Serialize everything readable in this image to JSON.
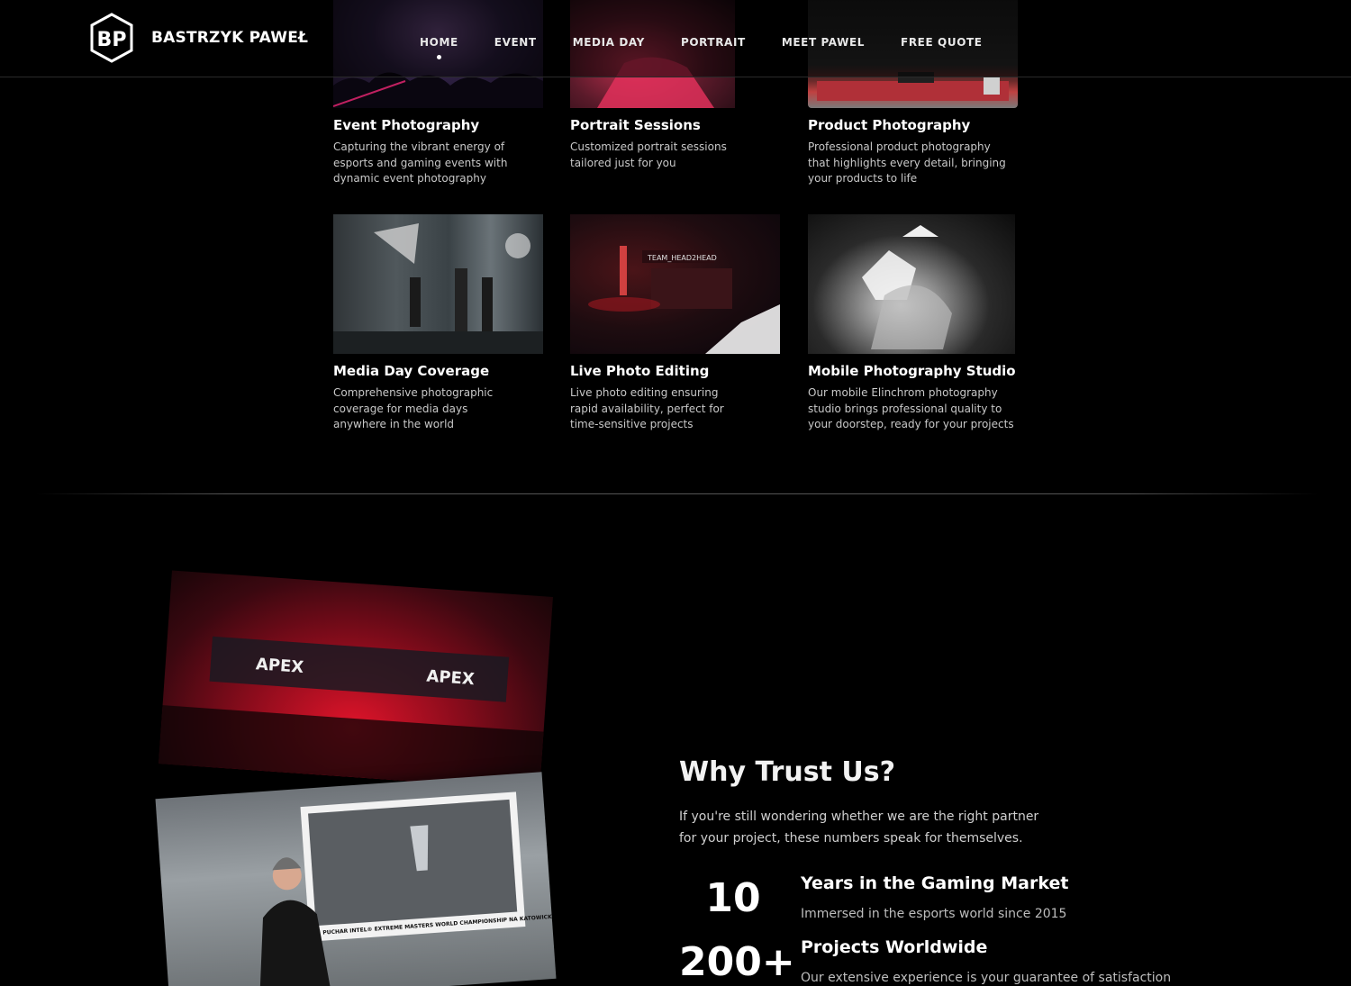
{
  "header": {
    "brand": "BASTRZYK PAWEŁ",
    "nav": [
      {
        "label": "HOME",
        "active": true
      },
      {
        "label": "EVENT"
      },
      {
        "label": "MEDIA DAY"
      },
      {
        "label": "PORTRAIT"
      },
      {
        "label": "MEET PAWEL"
      },
      {
        "label": "FREE QUOTE"
      }
    ]
  },
  "services": [
    {
      "title": "Event Photography",
      "description": "Capturing the vibrant energy of esports and gaming events with dynamic event photography"
    },
    {
      "title": "Portrait Sessions",
      "description": "Customized portrait sessions tailored just for you"
    },
    {
      "title": "Product Photography",
      "description": "Professional product photography that highlights every detail, bringing your products to life"
    },
    {
      "title": "Media Day Coverage",
      "description": "Comprehensive photographic coverage for media days anywhere in the world"
    },
    {
      "title": "Live Photo Editing",
      "description": "Live photo editing ensuring rapid availability, perfect for time-sensitive projects"
    },
    {
      "title": "Mobile Photography Studio",
      "description": "Our mobile Elinchrom photography studio brings professional quality to your doorstep, ready for your projects"
    }
  ],
  "trust": {
    "title": "Why Trust Us?",
    "intro": "If you're still wondering whether we are the right partner for your project, these numbers speak for themselves.",
    "stats": [
      {
        "value": "10",
        "title": "Years in the Gaming Market",
        "description": "Immersed in the esports world since 2015"
      },
      {
        "value": "200+",
        "title": "Projects Worldwide",
        "description": "Our extensive experience is your guarantee of satisfaction"
      }
    ]
  },
  "photos": {
    "arena_banner": "APEX",
    "trophy_banner": "PUCHAR INTEL® EXTREME MASTERS WORLD CHAMPIONSHIP NA KATOWICKIM NIKISZOWCU",
    "live_screen_label": "TEAM_HEAD2HEAD"
  }
}
